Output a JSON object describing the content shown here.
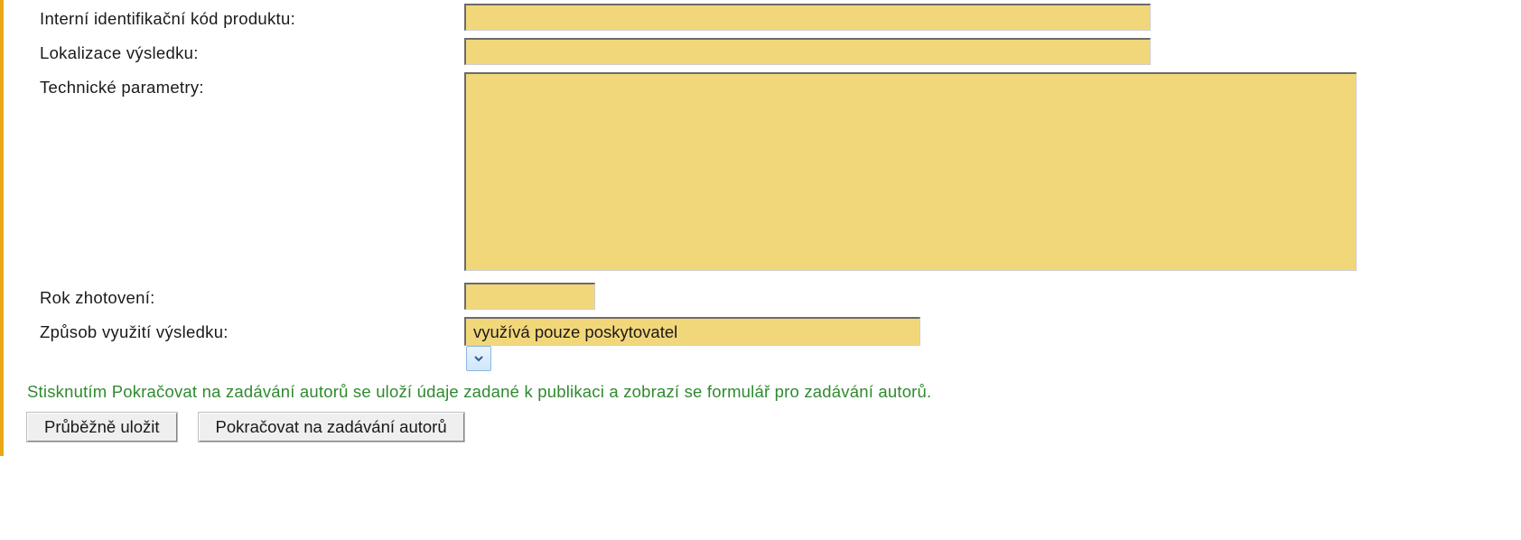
{
  "form": {
    "internal_code": {
      "label": "Interní identifikační kód produktu:",
      "value": ""
    },
    "localization": {
      "label": "Lokalizace výsledku:",
      "value": ""
    },
    "tech_params": {
      "label": "Technické parametry:",
      "value": ""
    },
    "year": {
      "label": "Rok zhotovení:",
      "value": ""
    },
    "usage": {
      "label": "Způsob využití výsledku:",
      "selected": "využívá pouze poskytovatel"
    }
  },
  "hint": "Stisknutím Pokračovat na zadávání autorů se uloží údaje zadané k publikaci a zobrazí se formulář pro zadávání autorů.",
  "buttons": {
    "save_draft": "Průběžně uložit",
    "continue_authors": "Pokračovat na zadávání autorů"
  }
}
